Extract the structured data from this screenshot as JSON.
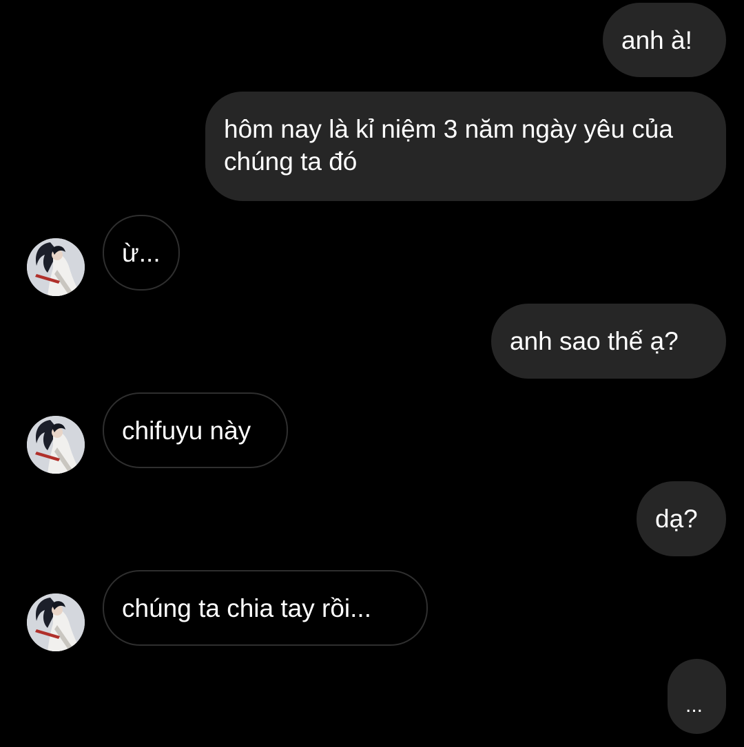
{
  "conversation": {
    "messages": [
      {
        "side": "outgoing",
        "text": "anh à!"
      },
      {
        "side": "outgoing",
        "text": "hôm nay là kỉ niệm 3 năm ngày yêu của chúng ta đó"
      },
      {
        "side": "incoming",
        "text": "ừ..."
      },
      {
        "side": "outgoing",
        "text": "anh sao thế ạ?"
      },
      {
        "side": "incoming",
        "text": "chifuyu này"
      },
      {
        "side": "outgoing",
        "text": "dạ?"
      },
      {
        "side": "incoming",
        "text": "chúng ta chia tay rồi..."
      },
      {
        "side": "outgoing",
        "text": "..."
      }
    ],
    "avatar": {
      "icon": "contact-avatar-icon"
    }
  },
  "colors": {
    "background": "#000000",
    "outgoing_bubble": "#262626",
    "incoming_border": "#2f2f2f",
    "text": "#ffffff"
  }
}
